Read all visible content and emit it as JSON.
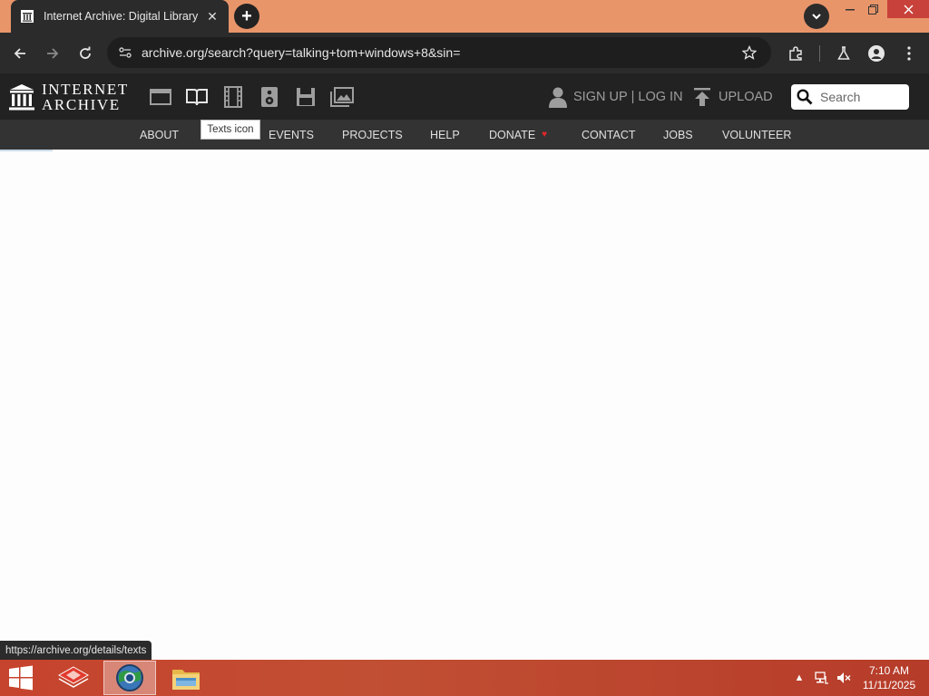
{
  "browser": {
    "tab_title": "Internet Archive: Digital Library",
    "url": "archive.org/search?query=talking+tom+windows+8&sin=",
    "status_url": "https://archive.org/details/texts"
  },
  "ia": {
    "logo_line1": "INTERNET",
    "logo_line2": "ARCHIVE",
    "media_icons": [
      "web-icon",
      "texts-icon",
      "video-icon",
      "audio-icon",
      "software-icon",
      "images-icon"
    ],
    "tooltip": "Texts icon",
    "sign_up": "SIGN UP",
    "separator": "|",
    "log_in": "LOG IN",
    "upload": "UPLOAD",
    "search_placeholder": "Search",
    "subnav": {
      "about": "ABOUT",
      "events": "EVENTS",
      "projects": "PROJECTS",
      "help": "HELP",
      "donate": "DONATE",
      "contact": "CONTACT",
      "jobs": "JOBS",
      "volunteer": "VOLUNTEER"
    },
    "donate_heart": "♥"
  },
  "taskbar": {
    "time": "7:10 AM",
    "date": "11/11/2025",
    "tray_arrow": "▲"
  },
  "colors": {
    "tabbar": "#e8956a",
    "chrome_dark": "#2b2b2b",
    "ia_header": "#222222",
    "ia_subnav": "#333333",
    "taskbar": "#c6432d"
  }
}
